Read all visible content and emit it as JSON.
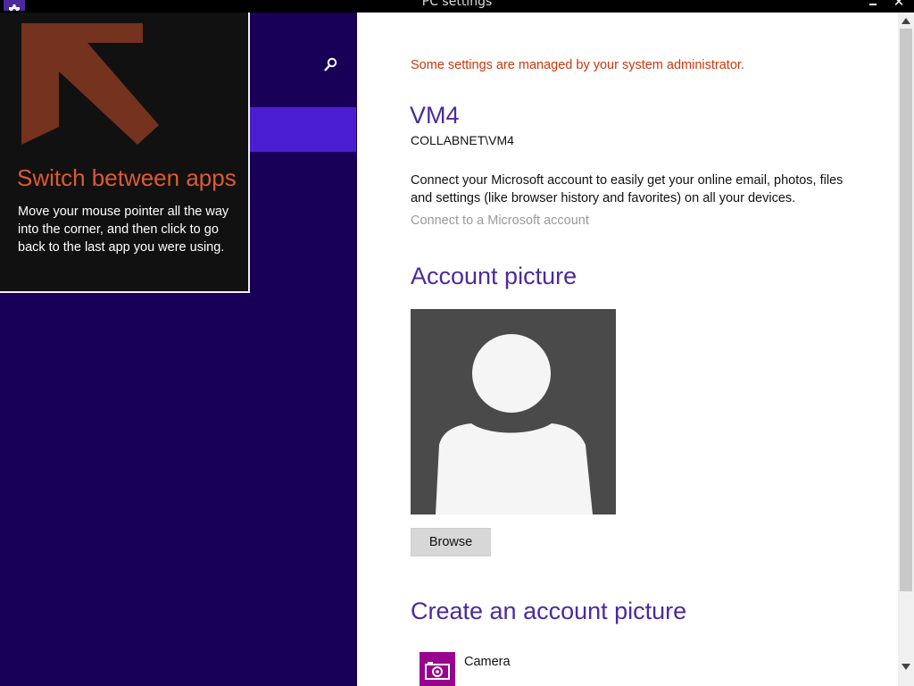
{
  "window": {
    "title": "PC settings",
    "icon": "gear-icon",
    "minimize": "minimize-icon",
    "close_label": "✕"
  },
  "nav": {
    "search_icon": "search-icon"
  },
  "tip": {
    "title": "Switch between apps",
    "body": "Move your mouse pointer all the way into the corner, and then click to go back to the last app you were using.",
    "arrow_icon": "arrow-up-left-icon"
  },
  "account": {
    "admin_notice": "Some settings are managed by your system administrator.",
    "name": "VM4",
    "id": "COLLABNET\\VM4",
    "ms_description": "Connect your Microsoft account to easily get your online email, photos, files and settings (like browser history and favorites) on all your devices.",
    "connect_link": "Connect to a Microsoft account"
  },
  "picture": {
    "heading": "Account picture",
    "browse_label": "Browse"
  },
  "create": {
    "heading": "Create an account picture",
    "camera_label": "Camera"
  },
  "colors": {
    "nav_background": "#180058",
    "nav_selected": "#4c1ed2",
    "heading": "#4b2aa0",
    "notice": "#c9380c",
    "tip_title": "#dc5a35",
    "camera_tile": "#97058f"
  }
}
